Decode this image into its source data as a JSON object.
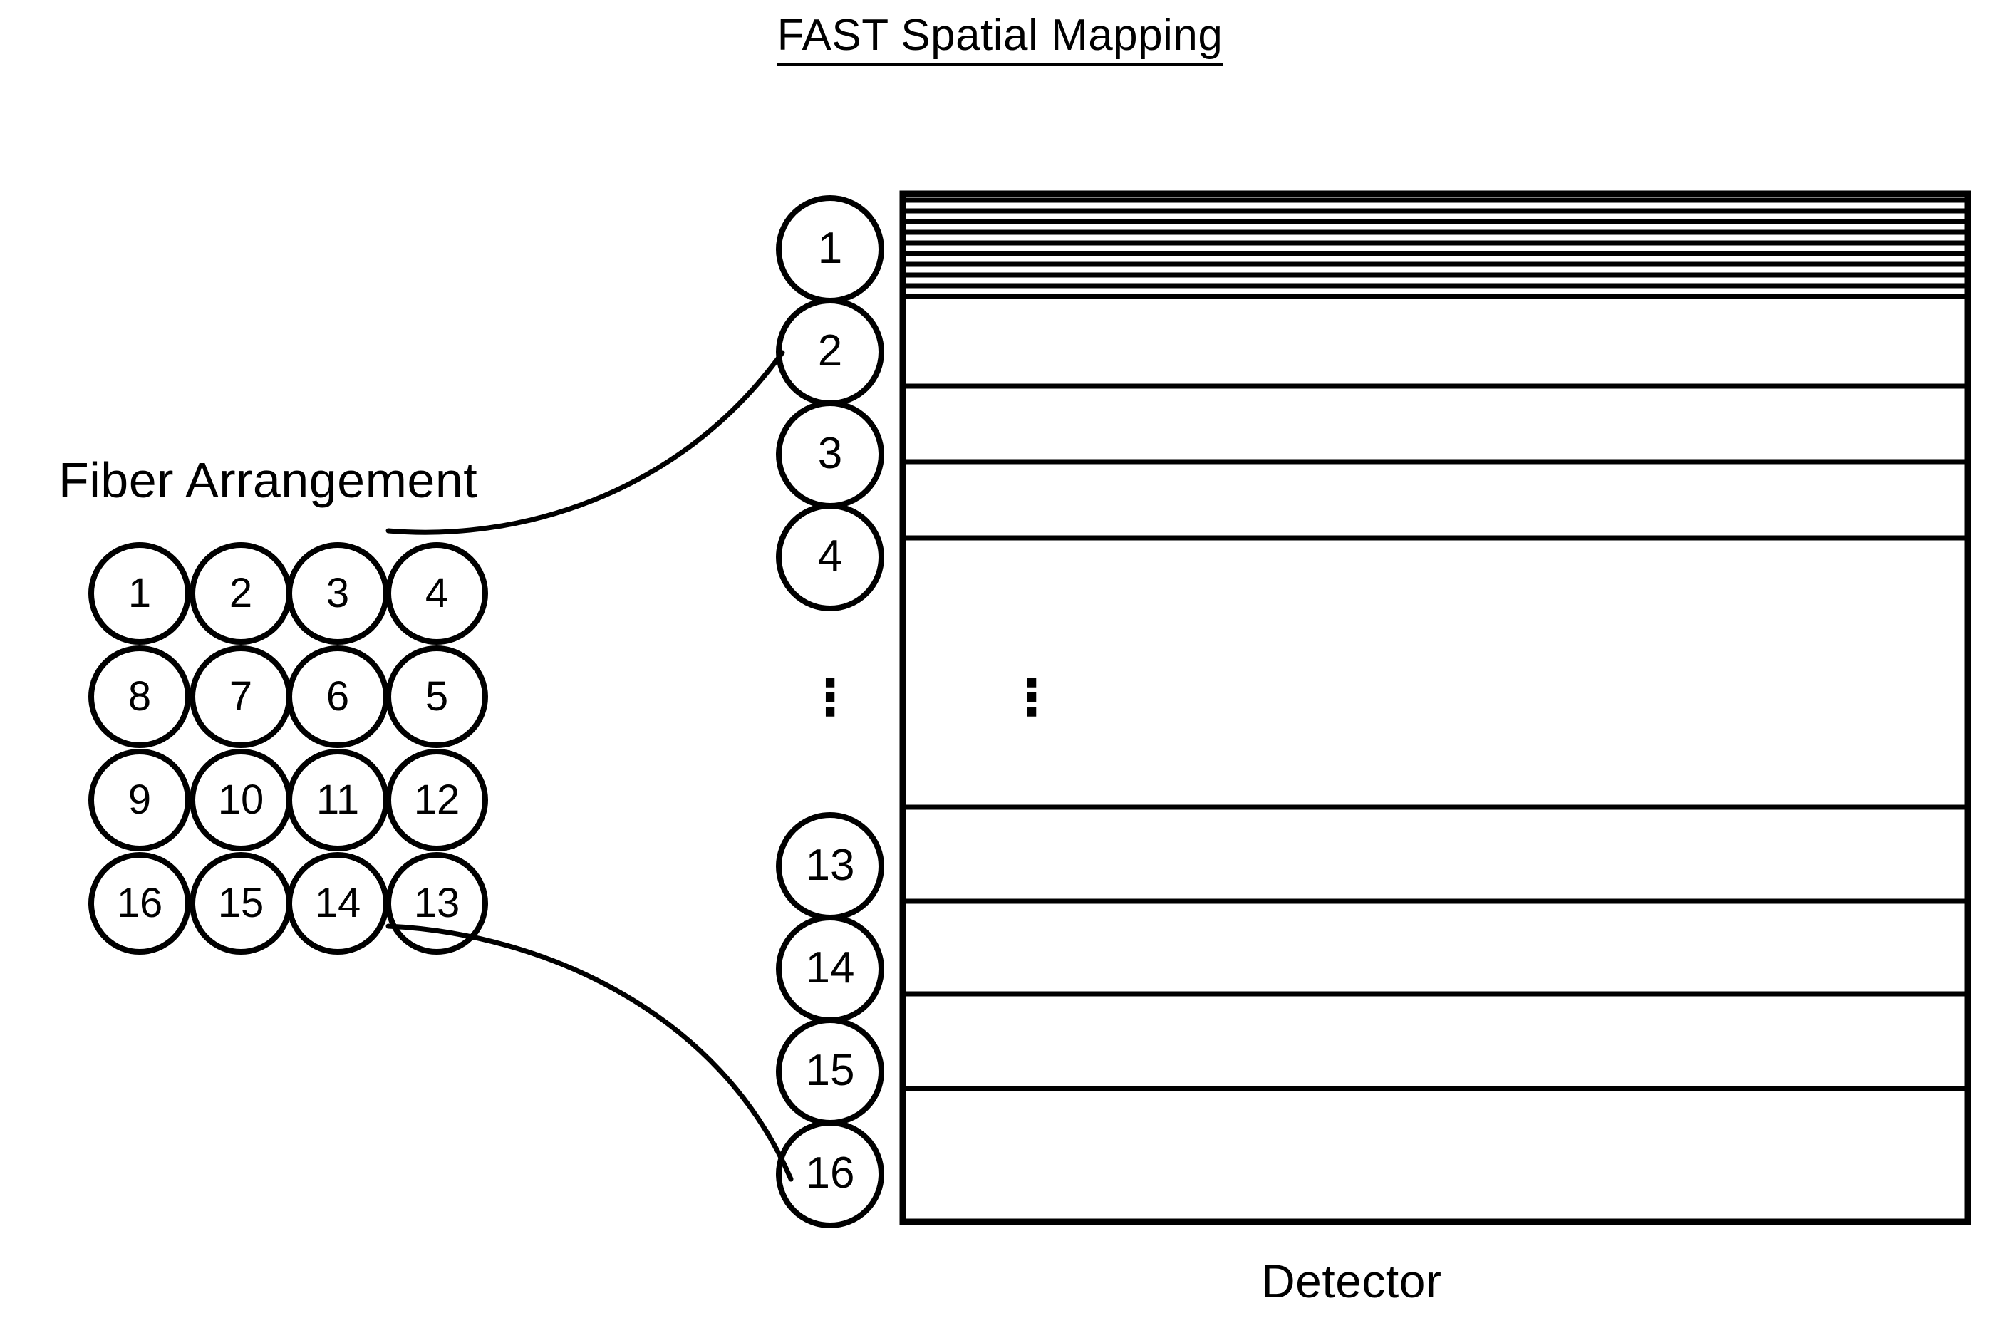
{
  "figure": {
    "title": "FAST Spatial Mapping",
    "fiber_label": "Fiber Arrangement",
    "detector_label": "Detector",
    "ellipsis": "⋮"
  },
  "fiber_arrangement": {
    "rows": 4,
    "cols": 4,
    "order": "serpentine",
    "grid": [
      [
        "1",
        "2",
        "3",
        "4"
      ],
      [
        "8",
        "7",
        "6",
        "5"
      ],
      [
        "9",
        "10",
        "11",
        "12"
      ],
      [
        "16",
        "15",
        "14",
        "13"
      ]
    ]
  },
  "fiber_column": {
    "total": 16,
    "visible_top": [
      "1",
      "2",
      "3",
      "4"
    ],
    "visible_bottom": [
      "13",
      "14",
      "15",
      "16"
    ],
    "hidden_marker": "⋮"
  },
  "detector": {
    "dense_band_lines": 10,
    "separator_count": 8,
    "ellipsis": "⋮"
  },
  "connectors": [
    {
      "from": "grid-circle-4",
      "to": "column-circle-2"
    },
    {
      "from": "grid-circle-13",
      "to": "column-circle-16"
    }
  ],
  "chart_data": {
    "type": "diagram",
    "title": "FAST Spatial Mapping",
    "description": "Mapping of a 4x4 fiber bundle arrangement onto a linear fiber column imaged across a detector's rows.",
    "fiber_grid_values": [
      1,
      2,
      3,
      4,
      8,
      7,
      6,
      5,
      9,
      10,
      11,
      12,
      16,
      15,
      14,
      13
    ],
    "column_values": [
      1,
      2,
      3,
      4,
      13,
      14,
      15,
      16
    ],
    "detector_tracks": 16
  },
  "colors": {
    "ink": "#000000",
    "paper": "#ffffff"
  }
}
